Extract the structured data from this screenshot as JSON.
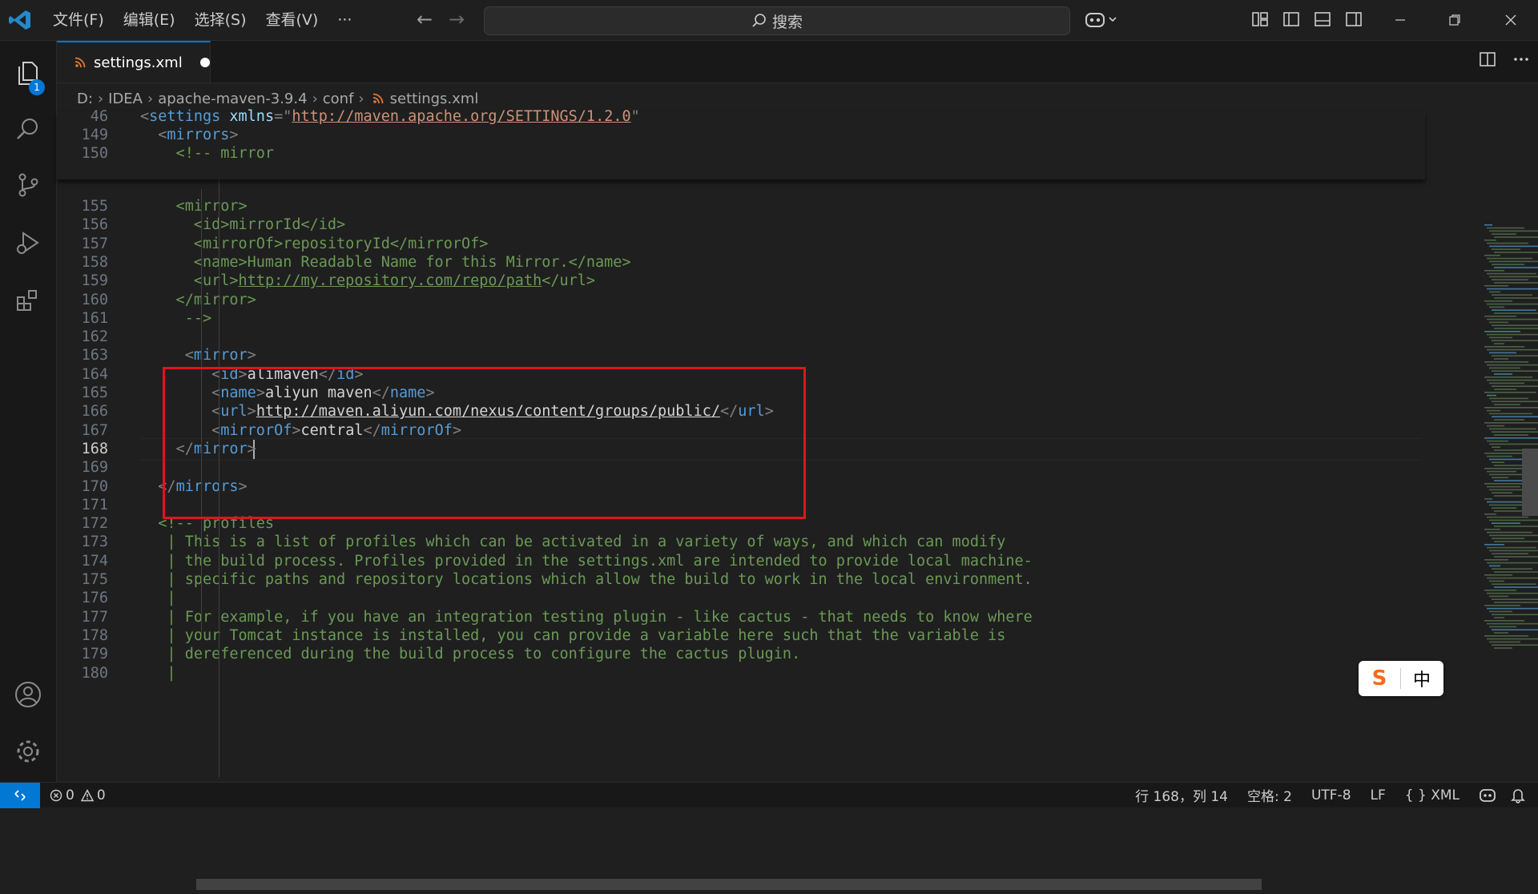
{
  "menu": [
    "文件(F)",
    "编辑(E)",
    "选择(S)",
    "查看(V)",
    "···"
  ],
  "search": {
    "label": "搜索"
  },
  "activity": {
    "explorer_badge": "1"
  },
  "tab": {
    "label": "settings.xml"
  },
  "breadcrumb": [
    "D:",
    "IDEA",
    "apache-maven-3.9.4",
    "conf",
    "settings.xml"
  ],
  "sticky": [
    {
      "num": "46",
      "code": [
        [
          "t-punc",
          "<"
        ],
        [
          "t-tag",
          "settings"
        ],
        [
          "t-punc",
          " "
        ],
        [
          "t-attr",
          "xmlns"
        ],
        [
          "t-punc",
          "="
        ],
        [
          "t-punc",
          "\""
        ],
        [
          "t-str",
          "http://maven.apache.org/SETTINGS/1.2.0"
        ],
        [
          "t-punc",
          "\""
        ]
      ]
    },
    {
      "num": "149",
      "code": [
        [
          "t-punc",
          "  <"
        ],
        [
          "t-tag",
          "mirrors"
        ],
        [
          "t-punc",
          ">"
        ]
      ]
    },
    {
      "num": "150",
      "code": [
        [
          "t-com",
          "    <!-- mirror"
        ]
      ]
    }
  ],
  "lines": [
    {
      "num": "155",
      "code": [
        [
          "t-com",
          "    <mirror>"
        ]
      ]
    },
    {
      "num": "156",
      "code": [
        [
          "t-com",
          "      <id>mirrorId</id>"
        ]
      ]
    },
    {
      "num": "157",
      "code": [
        [
          "t-com",
          "      <mirrorOf>repositoryId</mirrorOf>"
        ]
      ]
    },
    {
      "num": "158",
      "code": [
        [
          "t-com",
          "      <name>Human Readable Name for this Mirror.</name>"
        ]
      ]
    },
    {
      "num": "159",
      "code": [
        [
          "t-com",
          "      <url>"
        ],
        [
          "t-com u",
          "http://my.repository.com/repo/path"
        ],
        [
          "t-com",
          "</url>"
        ]
      ]
    },
    {
      "num": "160",
      "code": [
        [
          "t-com",
          "    </mirror>"
        ]
      ]
    },
    {
      "num": "161",
      "code": [
        [
          "t-com",
          "     -->"
        ]
      ]
    },
    {
      "num": "162",
      "code": []
    },
    {
      "num": "163",
      "code": [
        [
          "t-punc",
          "     <"
        ],
        [
          "t-tag",
          "mirror"
        ],
        [
          "t-punc",
          ">"
        ]
      ]
    },
    {
      "num": "164",
      "code": [
        [
          "t-punc",
          "        <"
        ],
        [
          "t-tag",
          "id"
        ],
        [
          "t-punc",
          ">"
        ],
        [
          "t-text",
          "alimaven"
        ],
        [
          "t-punc",
          "</"
        ],
        [
          "t-tag",
          "id"
        ],
        [
          "t-punc",
          ">"
        ]
      ]
    },
    {
      "num": "165",
      "code": [
        [
          "t-punc",
          "        <"
        ],
        [
          "t-tag",
          "name"
        ],
        [
          "t-punc",
          ">"
        ],
        [
          "t-text",
          "aliyun maven"
        ],
        [
          "t-punc",
          "</"
        ],
        [
          "t-tag",
          "name"
        ],
        [
          "t-punc",
          ">"
        ]
      ]
    },
    {
      "num": "166",
      "code": [
        [
          "t-punc",
          "        <"
        ],
        [
          "t-tag",
          "url"
        ],
        [
          "t-punc",
          ">"
        ],
        [
          "t-link",
          "http://maven.aliyun.com/nexus/content/groups/public/"
        ],
        [
          "t-punc",
          "</"
        ],
        [
          "t-tag",
          "url"
        ],
        [
          "t-punc",
          ">"
        ]
      ]
    },
    {
      "num": "167",
      "code": [
        [
          "t-punc",
          "        <"
        ],
        [
          "t-tag",
          "mirrorOf"
        ],
        [
          "t-punc",
          ">"
        ],
        [
          "t-text",
          "central"
        ],
        [
          "t-punc",
          "</"
        ],
        [
          "t-tag",
          "mirrorOf"
        ],
        [
          "t-punc",
          ">"
        ]
      ]
    },
    {
      "num": "168",
      "code": [
        [
          "t-punc",
          "    </"
        ],
        [
          "t-tag",
          "mirror"
        ],
        [
          "t-punc",
          ">"
        ]
      ]
    },
    {
      "num": "169",
      "code": []
    },
    {
      "num": "170",
      "code": [
        [
          "t-punc",
          "  </"
        ],
        [
          "t-tag",
          "mirrors"
        ],
        [
          "t-punc",
          ">"
        ]
      ]
    },
    {
      "num": "171",
      "code": []
    },
    {
      "num": "172",
      "code": [
        [
          "t-com",
          "  <!-- profiles"
        ]
      ]
    },
    {
      "num": "173",
      "code": [
        [
          "t-com",
          "   | This is a list of profiles which can be activated in a variety of ways, and which can modify"
        ]
      ]
    },
    {
      "num": "174",
      "code": [
        [
          "t-com",
          "   | the build process. Profiles provided in the settings.xml are intended to provide local machine-"
        ]
      ]
    },
    {
      "num": "175",
      "code": [
        [
          "t-com",
          "   | specific paths and repository locations which allow the build to work in the local environment."
        ]
      ]
    },
    {
      "num": "176",
      "code": [
        [
          "t-com",
          "   |"
        ]
      ]
    },
    {
      "num": "177",
      "code": [
        [
          "t-com",
          "   | For example, if you have an integration testing plugin - like cactus - that needs to know where"
        ]
      ]
    },
    {
      "num": "178",
      "code": [
        [
          "t-com",
          "   | your Tomcat instance is installed, you can provide a variable here such that the variable is"
        ]
      ]
    },
    {
      "num": "179",
      "code": [
        [
          "t-com",
          "   | dereferenced during the build process to configure the cactus plugin."
        ]
      ]
    },
    {
      "num": "180",
      "code": [
        [
          "t-com",
          "   |"
        ]
      ]
    }
  ],
  "current_line": "168",
  "ime": {
    "logo": "S",
    "mode": "中"
  },
  "status": {
    "errors": "0",
    "warnings": "0",
    "position": "行 168，列 14",
    "spaces": "空格: 2",
    "encoding": "UTF-8",
    "eol": "LF",
    "language": "{ } XML"
  },
  "colors": {
    "accent": "#0078d4",
    "highlight_box": "#e0141e"
  }
}
